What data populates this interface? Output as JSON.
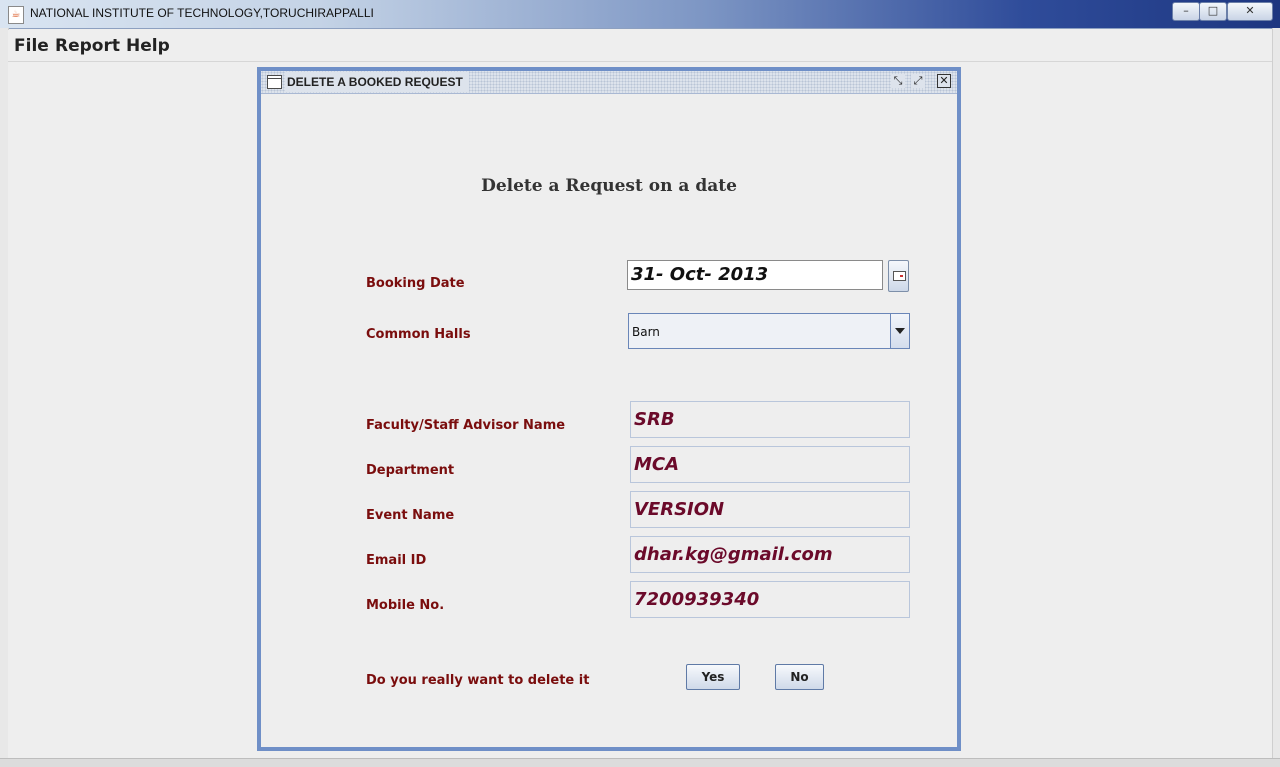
{
  "window": {
    "title": "NATIONAL INSTITUTE OF TECHNOLOGY,TORUCHIRAPPALLI",
    "min_glyph": "–",
    "max_glyph": "□",
    "close_glyph": "✕"
  },
  "menu": {
    "items": [
      "File",
      "Report",
      "Help"
    ]
  },
  "frame": {
    "title": "DELETE A BOOKED REQUEST",
    "iconify_glyph": "⤡",
    "maximize_glyph": "⤢",
    "close_glyph": "✕"
  },
  "form": {
    "heading": "Delete a Request on a date",
    "booking_date": {
      "label": "Booking Date",
      "value": "31- Oct- 2013"
    },
    "common_halls": {
      "label": "Common Halls",
      "value": "Barn"
    },
    "advisor": {
      "label": "Faculty/Staff Advisor Name",
      "value": "SRB"
    },
    "department": {
      "label": "Department",
      "value": "MCA"
    },
    "event": {
      "label": "Event Name",
      "value": "VERSION"
    },
    "email": {
      "label": "Email ID",
      "value": "dhar.kg@gmail.com"
    },
    "mobile": {
      "label": "Mobile No.",
      "value": "7200939340"
    },
    "confirm": {
      "label": "Do you really want to delete it",
      "yes": "Yes",
      "no": "No"
    }
  },
  "colors": {
    "label": "#7a0d0d",
    "value": "#6b0a2a",
    "frame_border": "#6f8fc7"
  }
}
